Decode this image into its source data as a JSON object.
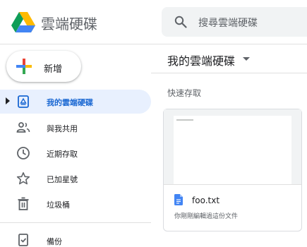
{
  "header": {
    "app_title": "雲端硬碟",
    "search_placeholder": "搜尋雲端硬碟"
  },
  "sidebar": {
    "new_label": "新增",
    "items": [
      {
        "label": "我的雲端硬碟",
        "icon": "my-drive-icon",
        "active": true
      },
      {
        "label": "與我共用",
        "icon": "shared-people-icon",
        "active": false
      },
      {
        "label": "近期存取",
        "icon": "clock-icon",
        "active": false
      },
      {
        "label": "已加星號",
        "icon": "star-icon",
        "active": false
      },
      {
        "label": "垃圾桶",
        "icon": "trash-icon",
        "active": false
      },
      {
        "label": "備份",
        "icon": "backup-icon",
        "active": false
      }
    ]
  },
  "main": {
    "title": "我的雲端硬碟",
    "quick_access_label": "快速存取",
    "files": [
      {
        "name": "foo.txt",
        "subtitle": "你剛剛編輯過這份文件",
        "icon": "doc-icon"
      }
    ]
  },
  "colors": {
    "accent": "#1967d2",
    "active_bg": "#e8f0fe",
    "search_bg": "#f1f3f4",
    "doc_icon": "#4285f4"
  }
}
